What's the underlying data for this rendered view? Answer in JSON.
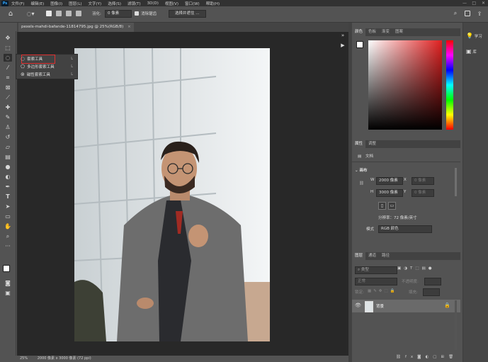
{
  "menubar": {
    "logo": "Ps",
    "items": [
      "文件(F)",
      "编辑(E)",
      "图像(I)",
      "图层(L)",
      "文字(Y)",
      "选择(S)",
      "滤镜(T)",
      "3D(D)",
      "视图(V)",
      "窗口(W)",
      "帮助(H)"
    ]
  },
  "options": {
    "feather_label": "羽化:",
    "feather_value": "0 像素",
    "antialias_label": "消除锯齿",
    "select_mask_button": "选择并遮住 ..."
  },
  "document": {
    "tab_title": "pexels-mahdi-bafande-11814795.jpg @ 25%(RGB/8)",
    "tab_close": "×"
  },
  "status": {
    "zoom": "25%",
    "size": "2000 像素 x 3000 像素 (72 ppi)"
  },
  "flyout": {
    "items": [
      {
        "label": "套索工具",
        "shortcut": "L"
      },
      {
        "label": "多边形套索工具",
        "shortcut": "L"
      },
      {
        "label": "磁性套索工具",
        "shortcut": "L"
      }
    ]
  },
  "color_panel": {
    "tabs": [
      "颜色",
      "色板",
      "渐变",
      "图案"
    ],
    "hue_color": "#e02020"
  },
  "properties_panel": {
    "tabs": [
      "属性",
      "调整"
    ],
    "doc_label": "文档",
    "canvas_section": "画布",
    "w_label": "W",
    "w_value": "2000 像素",
    "h_label": "H",
    "h_value": "3000 像素",
    "x_label": "X",
    "y_label": "Y",
    "x_placeholder": "0 像素",
    "y_placeholder": "0 像素",
    "resolution": "分辨率：72 像素/英寸",
    "mode_label": "模式",
    "mode_value": "RGB 颜色"
  },
  "layers_panel": {
    "tabs": [
      "图层",
      "通道",
      "路径"
    ],
    "filter_placeholder": "类型",
    "blend_mode": "正常",
    "opacity_label": "不透明度:",
    "lock_label": "锁定:",
    "fill_label": "填充:",
    "layer_name": "背景"
  },
  "right_icons": {
    "learn_label": "学习",
    "library_label": "库"
  }
}
